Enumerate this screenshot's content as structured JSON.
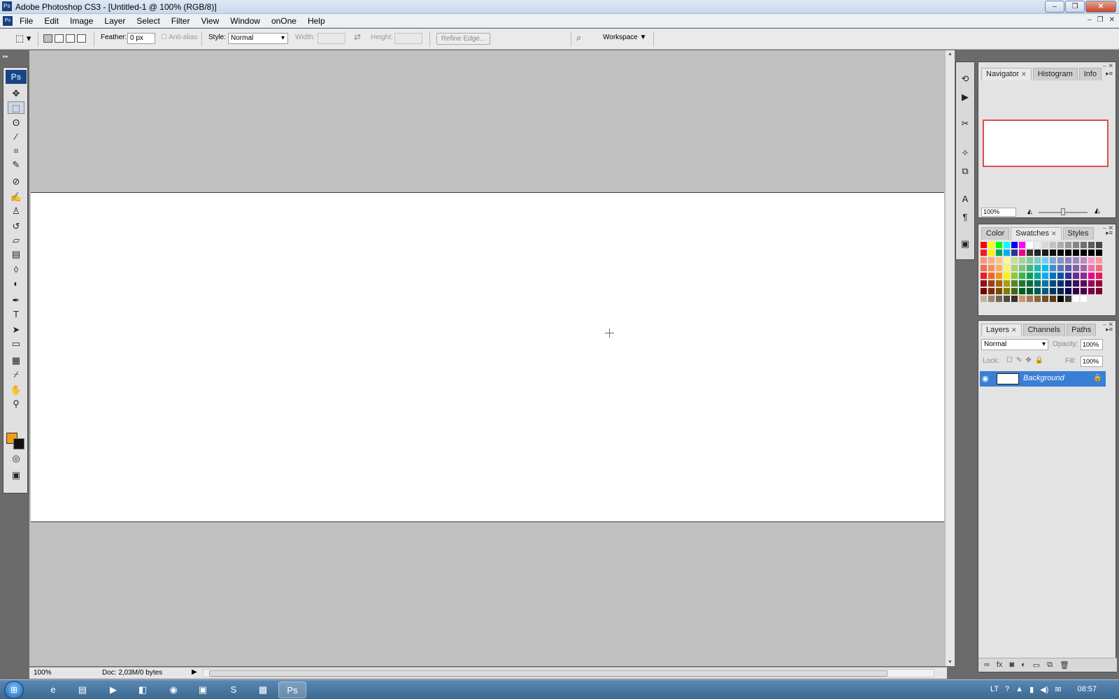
{
  "window": {
    "title": "Adobe Photoshop CS3 - [Untitled-1 @ 100% (RGB/8)]",
    "app_badge": "Ps",
    "buttons": [
      "‒",
      "❐",
      "✕"
    ]
  },
  "menu": {
    "items": [
      "File",
      "Edit",
      "Image",
      "Layer",
      "Select",
      "Filter",
      "View",
      "Window",
      "onOne",
      "Help"
    ],
    "doc_buttons": [
      "‒",
      "❐",
      "✕"
    ]
  },
  "options": {
    "feather_label": "Feather:",
    "feather_value": "0 px",
    "antialias_label": "Anti-alias",
    "style_label": "Style:",
    "style_value": "Normal",
    "width_label": "Width:",
    "height_label": "Height:",
    "refine_edge": "Refine Edge...",
    "workspace": "Workspace"
  },
  "tools": {
    "badge": "Ps",
    "items": [
      {
        "name": "move-tool",
        "glyph": "✥"
      },
      {
        "name": "marquee-tool",
        "glyph": "⬚"
      },
      {
        "name": "lasso-tool",
        "glyph": "ʘ"
      },
      {
        "name": "magic-wand-tool",
        "glyph": "⁄"
      },
      {
        "name": "crop-tool",
        "glyph": "⌗"
      },
      {
        "name": "slice-tool",
        "glyph": "✎"
      },
      {
        "name": "healing-brush-tool",
        "glyph": "⊘"
      },
      {
        "name": "brush-tool",
        "glyph": "✍"
      },
      {
        "name": "clone-stamp-tool",
        "glyph": "♙"
      },
      {
        "name": "history-brush-tool",
        "glyph": "↺"
      },
      {
        "name": "eraser-tool",
        "glyph": "▱"
      },
      {
        "name": "gradient-tool",
        "glyph": "▤"
      },
      {
        "name": "blur-tool",
        "glyph": "◊"
      },
      {
        "name": "dodge-tool",
        "glyph": "◐"
      },
      {
        "name": "pen-tool",
        "glyph": "✒"
      },
      {
        "name": "type-tool",
        "glyph": "T"
      },
      {
        "name": "path-selection-tool",
        "glyph": "➤"
      },
      {
        "name": "rectangle-tool",
        "glyph": "▭"
      },
      {
        "name": "notes-tool",
        "glyph": "▦"
      },
      {
        "name": "eyedropper-tool",
        "glyph": "⌿"
      },
      {
        "name": "hand-tool",
        "glyph": "✋"
      },
      {
        "name": "zoom-tool",
        "glyph": "⚲"
      }
    ]
  },
  "colors": {
    "foreground": "#f49d13",
    "background": "#111111"
  },
  "status": {
    "zoom": "100%",
    "doc": "Doc: 2,03M/0 bytes"
  },
  "dock": {
    "icons": [
      "history-icon",
      "actions-icon",
      "tools-presets-icon",
      "brushes-icon",
      "clone-source-icon",
      "character-icon",
      "paragraph-icon",
      "layer-comps-icon"
    ],
    "glyphs": [
      "⟲",
      "▶",
      "✂",
      "✧",
      "⧉",
      "A",
      "¶",
      "▣"
    ]
  },
  "navigator": {
    "tabs": [
      "Navigator",
      "Histogram",
      "Info"
    ],
    "zoom": "100%"
  },
  "swatches_panel": {
    "tabs": [
      "Color",
      "Swatches",
      "Styles"
    ]
  },
  "layers_panel": {
    "tabs": [
      "Layers",
      "Channels",
      "Paths"
    ],
    "blend": "Normal",
    "opacity_label": "Opacity:",
    "opacity": "100%",
    "lock_label": "Lock:",
    "fill_label": "Fill:",
    "fill": "100%",
    "layer_name": "Background"
  },
  "taskbar": {
    "language": "LT",
    "clock": "08:57",
    "apps": [
      "internet-explorer-icon",
      "explorer-icon",
      "media-player-icon",
      "acdsee-icon",
      "firefox-icon",
      "image-viewer-icon",
      "skype-icon",
      "photo-icon",
      "photoshop-icon"
    ],
    "glyphs": [
      "e",
      "▤",
      "▶",
      "◧",
      "◉",
      "▣",
      "S",
      "▩",
      "Ps"
    ]
  }
}
